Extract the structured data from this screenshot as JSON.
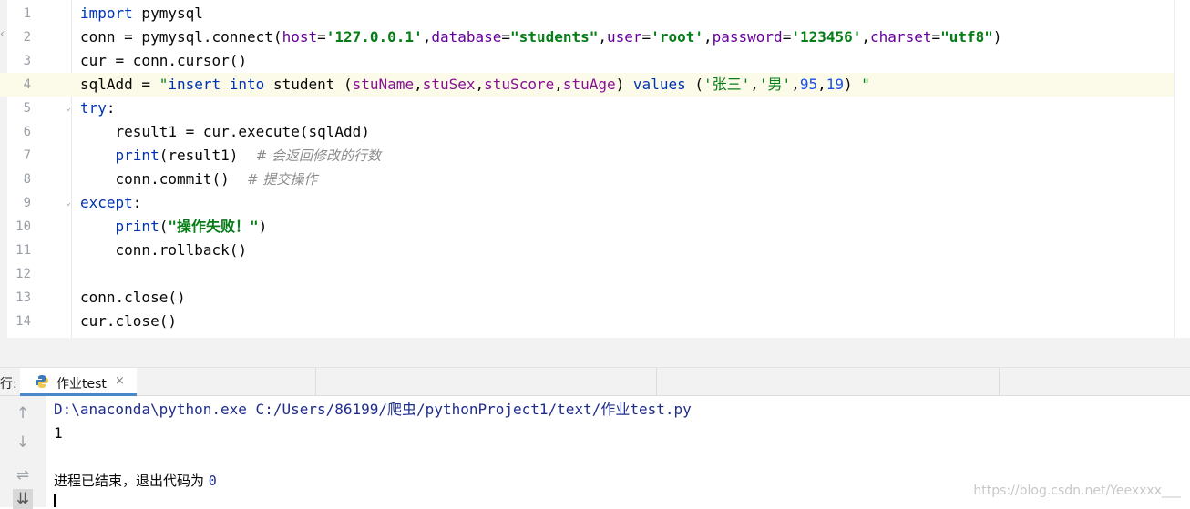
{
  "editor": {
    "line_numbers": [
      "1",
      "2",
      "3",
      "4",
      "5",
      "6",
      "7",
      "8",
      "9",
      "10",
      "11",
      "12",
      "13",
      "14"
    ],
    "line1": {
      "kw": "import",
      "rest": " pymysql"
    },
    "line2": {
      "a": "conn = pymysql.connect(",
      "p1": "host",
      "e1": "=",
      "v1": "'127.0.0.1'",
      "c1": ",",
      "p2": "database",
      "e2": "=",
      "v2": "\"students\"",
      "c2": ",",
      "p3": "user",
      "e3": "=",
      "v3": "'root'",
      "c3": ",",
      "p4": "password",
      "e4": "=",
      "v4": "'123456'",
      "c4": ",",
      "p5": "charset",
      "e5": "=",
      "v5": "\"utf8\"",
      "end": ")"
    },
    "line3": {
      "text": "cur = conn.cursor()"
    },
    "line4": {
      "a": "sqlAdd = ",
      "q1": "\"",
      "k1": "insert into",
      "t1": " student (",
      "col1": "stuName",
      "cm1": ",",
      "col2": "stuSex",
      "cm2": ",",
      "col3": "stuScore",
      "cm3": ",",
      "col4": "stuAge",
      "t2": ") ",
      "k2": "values",
      "t3": " (",
      "s1": "'张三'",
      "cm4": ",",
      "s2": "'男'",
      "cm5": ",",
      "n1": "95",
      "cm6": ",",
      "n2": "19",
      "t4": ") ",
      "q2": "\""
    },
    "line5": {
      "kw": "try",
      "rest": ":"
    },
    "line6": {
      "text": "    result1 = cur.execute(sqlAdd)"
    },
    "line7": {
      "indent": "    ",
      "kw": "print",
      "rest": "(result1)  ",
      "comment": "# 会返回修改的行数"
    },
    "line8": {
      "text": "    conn.commit()  ",
      "comment": "# 提交操作"
    },
    "line9": {
      "kw": "except",
      "rest": ":"
    },
    "line10": {
      "indent": "    ",
      "kw": "print",
      "open": "(",
      "str": "\"操作失败！\"",
      "close": ")"
    },
    "line11": {
      "text": "    conn.rollback()"
    },
    "line12": {
      "text": ""
    },
    "line13": {
      "text": "conn.close()"
    },
    "line14": {
      "text": "cur.close()"
    }
  },
  "run_panel": {
    "label": "行:",
    "tab_name": "作业test",
    "close_glyph": "×",
    "icons": [
      "up-arrow-icon",
      "down-arrow-icon",
      "soft-wrap-icon",
      "scroll-to-end-icon"
    ]
  },
  "console": {
    "command": "D:\\anaconda\\python.exe C:/Users/86199/爬虫/pythonProject1/text/作业test.py",
    "output": "1",
    "exit_text": "进程已结束，退出代码为 ",
    "exit_code": "0"
  },
  "watermark": "https://blog.csdn.net/Yeexxxx___",
  "colors": {
    "keyword": "#0033b3",
    "string": "#067d17",
    "parameter": "#660099",
    "number": "#1750eb",
    "comment": "#8c8c8c",
    "current_line": "#fcfae8",
    "tab_underline": "#4a88c7"
  }
}
